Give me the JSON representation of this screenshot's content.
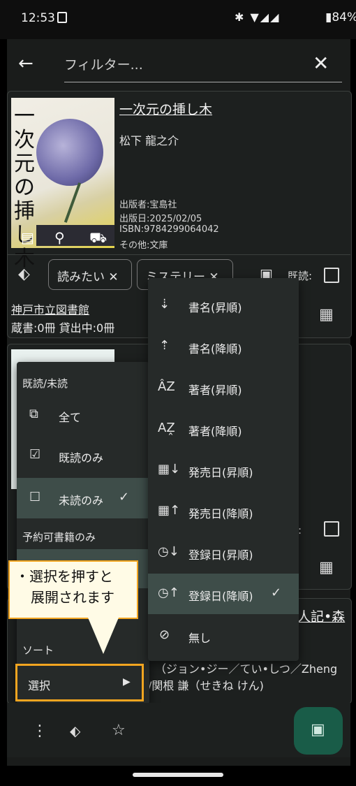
{
  "status": {
    "time": "12:53",
    "battery": "84%"
  },
  "toolbar": {
    "back_icon": "arrow-left-icon",
    "filter_placeholder": "フィルター...",
    "close_icon": "close-icon"
  },
  "book1": {
    "title": "一次元の挿し木",
    "author": "松下 龍之介",
    "cover_vertical": "一次元の挿し木",
    "publisher": "出版者:宝島社",
    "pubdate": "出版日:2025/02/05",
    "isbn": "ISBN:9784299064042",
    "other": "その他:文庫",
    "tags": [
      "読みたい ✕",
      "ミステリー ✕"
    ],
    "read_label": "既読:",
    "library": "神戸市立図書館",
    "holdings": "蔵書:0冊  貸出中:0冊"
  },
  "book2": {
    "read_label": "読:",
    "title_partial": "人記•森",
    "author_line1": "（ジョン•ジー／てい•しつ／Zheng",
    "author_line2": "/関根 謙（せきね けん)"
  },
  "filter_menu": {
    "read_header": "既読/未読",
    "items": [
      "全て",
      "既読のみ",
      "未読のみ"
    ],
    "reserve_header": "予約可書籍のみ",
    "sort_header": "ソート",
    "select_label": "選択"
  },
  "sort_menu": {
    "items": [
      "書名(昇順)",
      "書名(降順)",
      "著者(昇順)",
      "著者(降順)",
      "発売日(昇順)",
      "発売日(降順)",
      "登録日(昇順)",
      "登録日(降順)",
      "無し"
    ]
  },
  "callout": {
    "line1": "・選択を押すと",
    "line2": "展開されます"
  },
  "colors": {
    "accent": "#f2a520",
    "fab": "#195c48",
    "selected_row": "#3e4d49"
  }
}
